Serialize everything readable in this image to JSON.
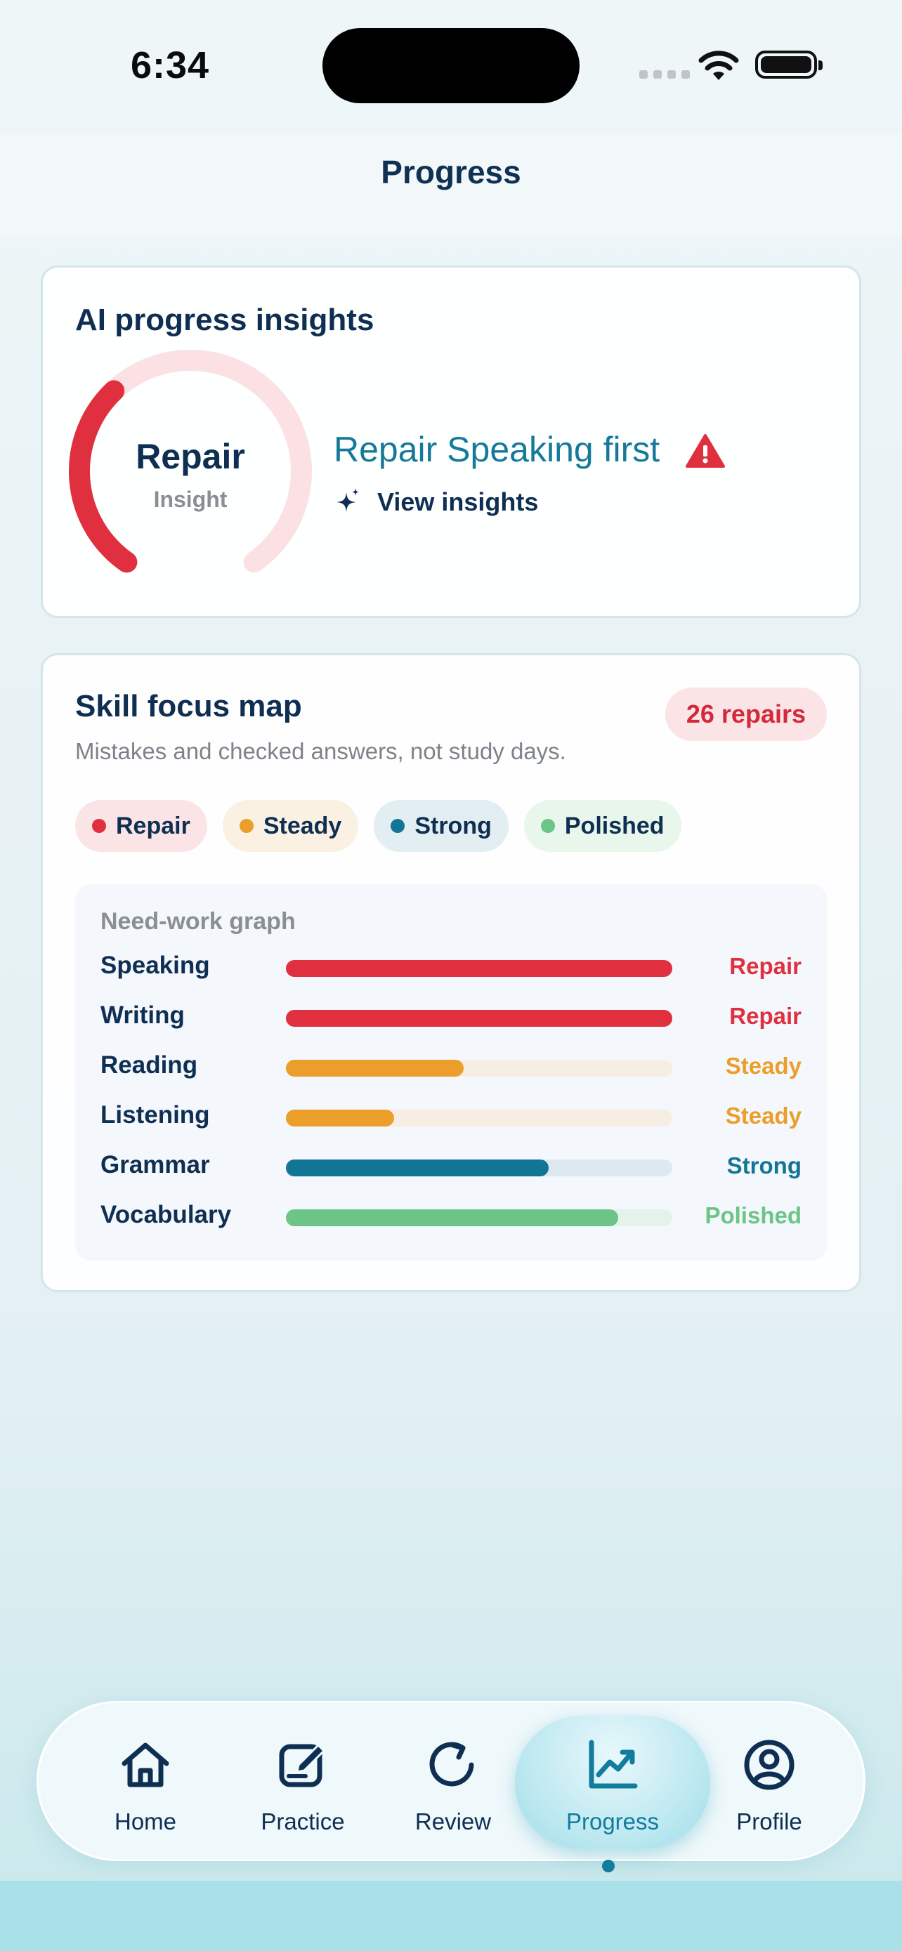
{
  "status_bar": {
    "time": "6:34"
  },
  "header": {
    "title": "Progress"
  },
  "insights": {
    "title": "AI progress insights",
    "gauge_label": "Repair",
    "gauge_sublabel": "Insight",
    "gauge_level": 0.35,
    "recommendation": "Repair Speaking first",
    "view_label": "View insights"
  },
  "skill_map": {
    "title": "Skill focus map",
    "subtitle": "Mistakes and checked answers, not study days.",
    "badge": "26 repairs",
    "legend": [
      {
        "label": "Repair",
        "color": "#e0303f",
        "bg": "#fbe4e6"
      },
      {
        "label": "Steady",
        "color": "#eb9e2a",
        "bg": "#fbf1e2"
      },
      {
        "label": "Strong",
        "color": "#127595",
        "bg": "#e2eef2"
      },
      {
        "label": "Polished",
        "color": "#6cc486",
        "bg": "#e8f6ec"
      }
    ],
    "graph_title": "Need-work graph",
    "rows": [
      {
        "skill": "Speaking",
        "status": "Repair",
        "level": 1.0,
        "color": "#e0303f",
        "track": "#fbe0e3"
      },
      {
        "skill": "Writing",
        "status": "Repair",
        "level": 1.0,
        "color": "#e0303f",
        "track": "#fbe0e3"
      },
      {
        "skill": "Reading",
        "status": "Steady",
        "level": 0.46,
        "color": "#eb9e2a",
        "track": "#f6eee3"
      },
      {
        "skill": "Listening",
        "status": "Steady",
        "level": 0.28,
        "color": "#eb9e2a",
        "track": "#f6eee3"
      },
      {
        "skill": "Grammar",
        "status": "Strong",
        "level": 0.68,
        "color": "#127595",
        "track": "#dde9ef"
      },
      {
        "skill": "Vocabulary",
        "status": "Polished",
        "level": 0.86,
        "color": "#6cc486",
        "track": "#e4f3ea"
      }
    ]
  },
  "tabs": [
    {
      "label": "Home",
      "icon": "home-icon"
    },
    {
      "label": "Practice",
      "icon": "practice-icon"
    },
    {
      "label": "Review",
      "icon": "review-icon"
    },
    {
      "label": "Progress",
      "icon": "progress-icon",
      "active": true
    },
    {
      "label": "Profile",
      "icon": "profile-icon"
    }
  ]
}
